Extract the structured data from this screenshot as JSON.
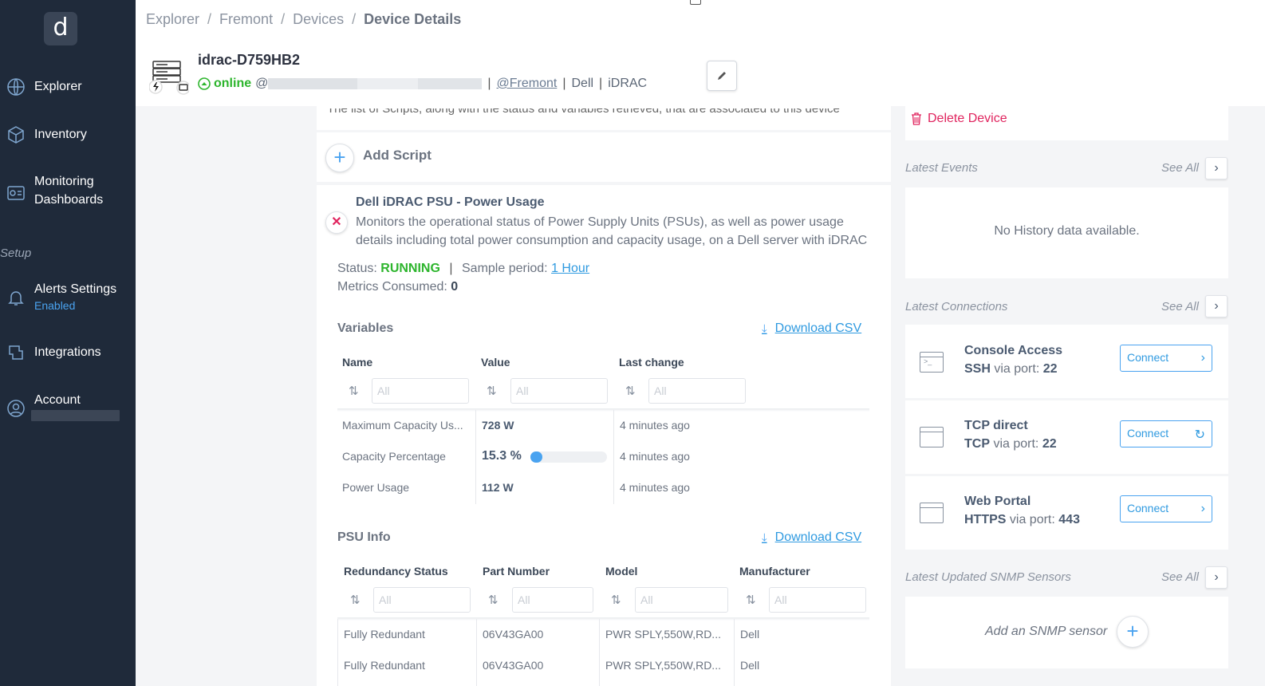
{
  "sidebar": {
    "logo": "d",
    "items": [
      {
        "label": "Explorer",
        "icon": "globe-icon"
      },
      {
        "label": "Inventory",
        "icon": "cube-icon"
      },
      {
        "label": "Monitoring Dashboards",
        "label_line1": "Monitoring",
        "label_line2": "Dashboards",
        "icon": "dashboard-icon"
      },
      {
        "label": "Alerts Settings",
        "sub": "Enabled",
        "icon": "bell-icon"
      },
      {
        "label": "Integrations",
        "icon": "integrations-icon"
      },
      {
        "label": "Account",
        "icon": "user-icon"
      }
    ],
    "setup_label": "Setup"
  },
  "breadcrumb": [
    "Explorer",
    "Fremont",
    "Devices",
    "Device Details"
  ],
  "device": {
    "name": "idrac-D759HB2",
    "status": "online",
    "at": "@",
    "location": "@Fremont",
    "vendor": "Dell",
    "type": "iDRAC"
  },
  "scripts": {
    "list_description": "The list of Scripts, along with the status and variables retrieved, that are associated to this device",
    "add_label": "Add Script"
  },
  "script": {
    "title": "Dell iDRAC PSU - Power Usage",
    "description": "Monitors the operational status of Power Supply Units (PSUs), as well as power usage details including total power consumption and capacity usage, on a Dell server with iDRAC",
    "status_label": "Status:",
    "status": "RUNNING",
    "sample_label": "Sample period:",
    "sample_period": "1 Hour",
    "metrics_label": "Metrics Consumed:",
    "metrics_consumed": "0"
  },
  "variables": {
    "title": "Variables",
    "download": "Download CSV",
    "columns": [
      "Name",
      "Value",
      "Last change"
    ],
    "filter_placeholder": "All",
    "rows": [
      {
        "name": "Maximum Capacity Us...",
        "value": "728 W",
        "last_change": "4 minutes ago"
      },
      {
        "name": "Capacity Percentage",
        "value": "15.3 %",
        "last_change": "4 minutes ago",
        "progress": 0.153
      },
      {
        "name": "Power Usage",
        "value": "112 W",
        "last_change": "4 minutes ago"
      }
    ]
  },
  "psu_info": {
    "title": "PSU Info",
    "download": "Download CSV",
    "columns": [
      "Redundancy Status",
      "Part Number",
      "Model",
      "Manufacturer"
    ],
    "filter_placeholder": "All",
    "rows": [
      {
        "redundancy": "Fully Redundant",
        "part": "06V43GA00",
        "model": "PWR SPLY,550W,RD...",
        "manufacturer": "Dell"
      },
      {
        "redundancy": "Fully Redundant",
        "part": "06V43GA00",
        "model": "PWR SPLY,550W,RD...",
        "manufacturer": "Dell"
      }
    ]
  },
  "right": {
    "delete_device": "Delete Device",
    "latest_events": "Latest Events",
    "see_all": "See All",
    "no_history": "No History data available.",
    "latest_connections": "Latest Connections",
    "connections": [
      {
        "title": "Console Access",
        "protocol": "SSH",
        "via": "via port:",
        "port": "22",
        "button": "Connect",
        "btn_icon": "chevron-right-icon"
      },
      {
        "title": "TCP direct",
        "protocol": "TCP",
        "via": "via port:",
        "port": "22",
        "button": "Connect",
        "btn_icon": "refresh-icon"
      },
      {
        "title": "Web Portal",
        "protocol": "HTTPS",
        "via": "via port:",
        "port": "443",
        "button": "Connect",
        "btn_icon": "chevron-right-icon"
      }
    ],
    "latest_snmp": "Latest Updated SNMP Sensors",
    "add_snmp": "Add an SNMP sensor"
  },
  "colors": {
    "sidebar_bg": "#1f2a3a",
    "accent": "#4aa3f0",
    "running": "#2db52d",
    "danger": "#e0245e"
  }
}
